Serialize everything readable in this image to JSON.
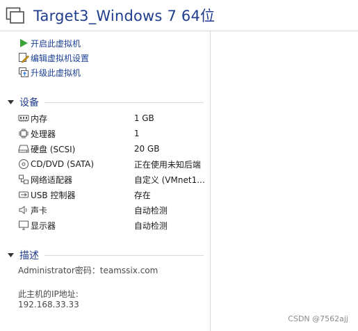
{
  "window": {
    "title": "Target3_Windows 7 64位"
  },
  "commands": [
    {
      "label": "开启此虚拟机",
      "icon": "play-icon"
    },
    {
      "label": "编辑虚拟机设置",
      "icon": "edit-settings-icon"
    },
    {
      "label": "升级此虚拟机",
      "icon": "upgrade-icon"
    }
  ],
  "devices": {
    "heading": "设备",
    "items": [
      {
        "name": "内存",
        "value": "1 GB",
        "icon": "memory-icon"
      },
      {
        "name": "处理器",
        "value": "1",
        "icon": "processor-icon"
      },
      {
        "name": "硬盘 (SCSI)",
        "value": "20 GB",
        "icon": "hard-disk-icon"
      },
      {
        "name": "CD/DVD (SATA)",
        "value": "正在使用未知后端",
        "icon": "cd-dvd-icon"
      },
      {
        "name": "网络适配器",
        "value": "自定义 (VMnet1...",
        "icon": "network-adapter-icon"
      },
      {
        "name": "USB 控制器",
        "value": "存在",
        "icon": "usb-icon"
      },
      {
        "name": "声卡",
        "value": "自动检测",
        "icon": "speaker-icon"
      },
      {
        "name": "显示器",
        "value": "自动检测",
        "icon": "monitor-icon"
      }
    ]
  },
  "description": {
    "heading": "描述",
    "line1": "Administrator密码：teamssix.com",
    "line2": "此主机的IP地址:",
    "line3": "192.168.33.33"
  },
  "watermark": "CSDN @7562ajj",
  "colors": {
    "title": "#1f3d8c",
    "link": "#1c3f95",
    "play": "#3aa33a"
  }
}
